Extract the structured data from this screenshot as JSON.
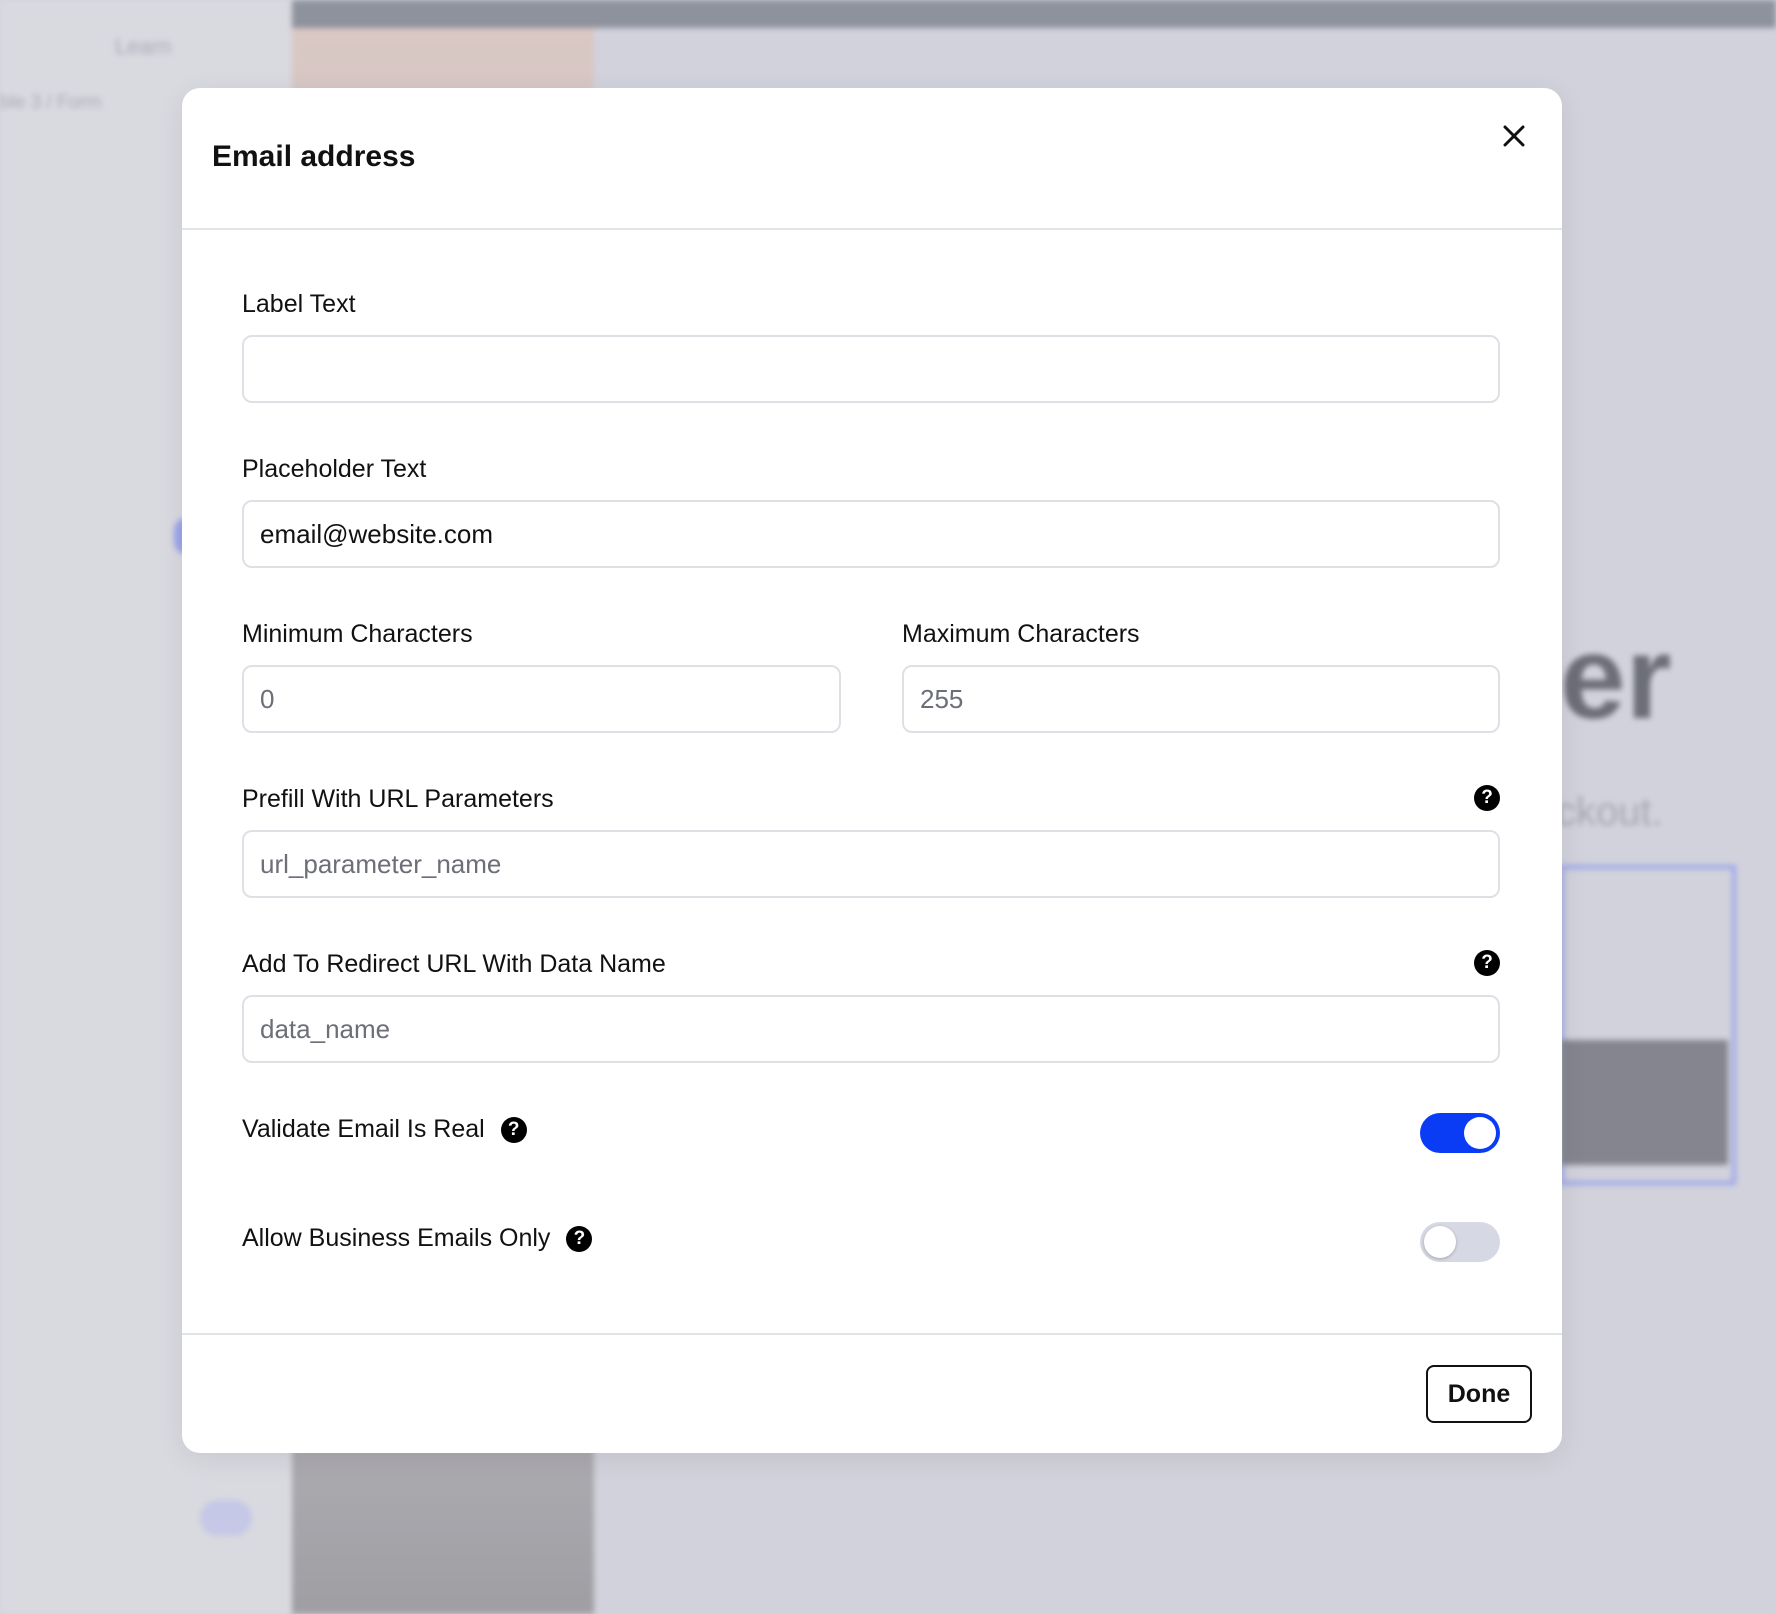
{
  "background": {
    "learn_label": "Learn",
    "breadcrumb": "ble 3 / Form",
    "big_heading_fragment": "er",
    "sub_text_fragment": "ckout."
  },
  "modal": {
    "title": "Email address",
    "label_text": {
      "label": "Label Text",
      "value": "",
      "placeholder": ""
    },
    "placeholder_text": {
      "label": "Placeholder Text",
      "value": "email@website.com"
    },
    "min_chars": {
      "label": "Minimum Characters",
      "placeholder": "0"
    },
    "max_chars": {
      "label": "Maximum Characters",
      "placeholder": "255"
    },
    "prefill_url": {
      "label": "Prefill With URL Parameters",
      "placeholder": "url_parameter_name"
    },
    "redirect_url": {
      "label": "Add To Redirect URL With Data Name",
      "placeholder": "data_name"
    },
    "validate_email": {
      "label": "Validate Email Is Real",
      "enabled": true
    },
    "business_only": {
      "label": "Allow Business Emails Only",
      "enabled": false
    },
    "help_glyph": "?",
    "done_label": "Done"
  },
  "colors": {
    "toggle_on": "#0b3cf5",
    "toggle_off": "#d6d9e4",
    "overlay": "#d3d3dc"
  },
  "icons": {
    "close": "close-icon",
    "help": "question-circle-icon"
  }
}
